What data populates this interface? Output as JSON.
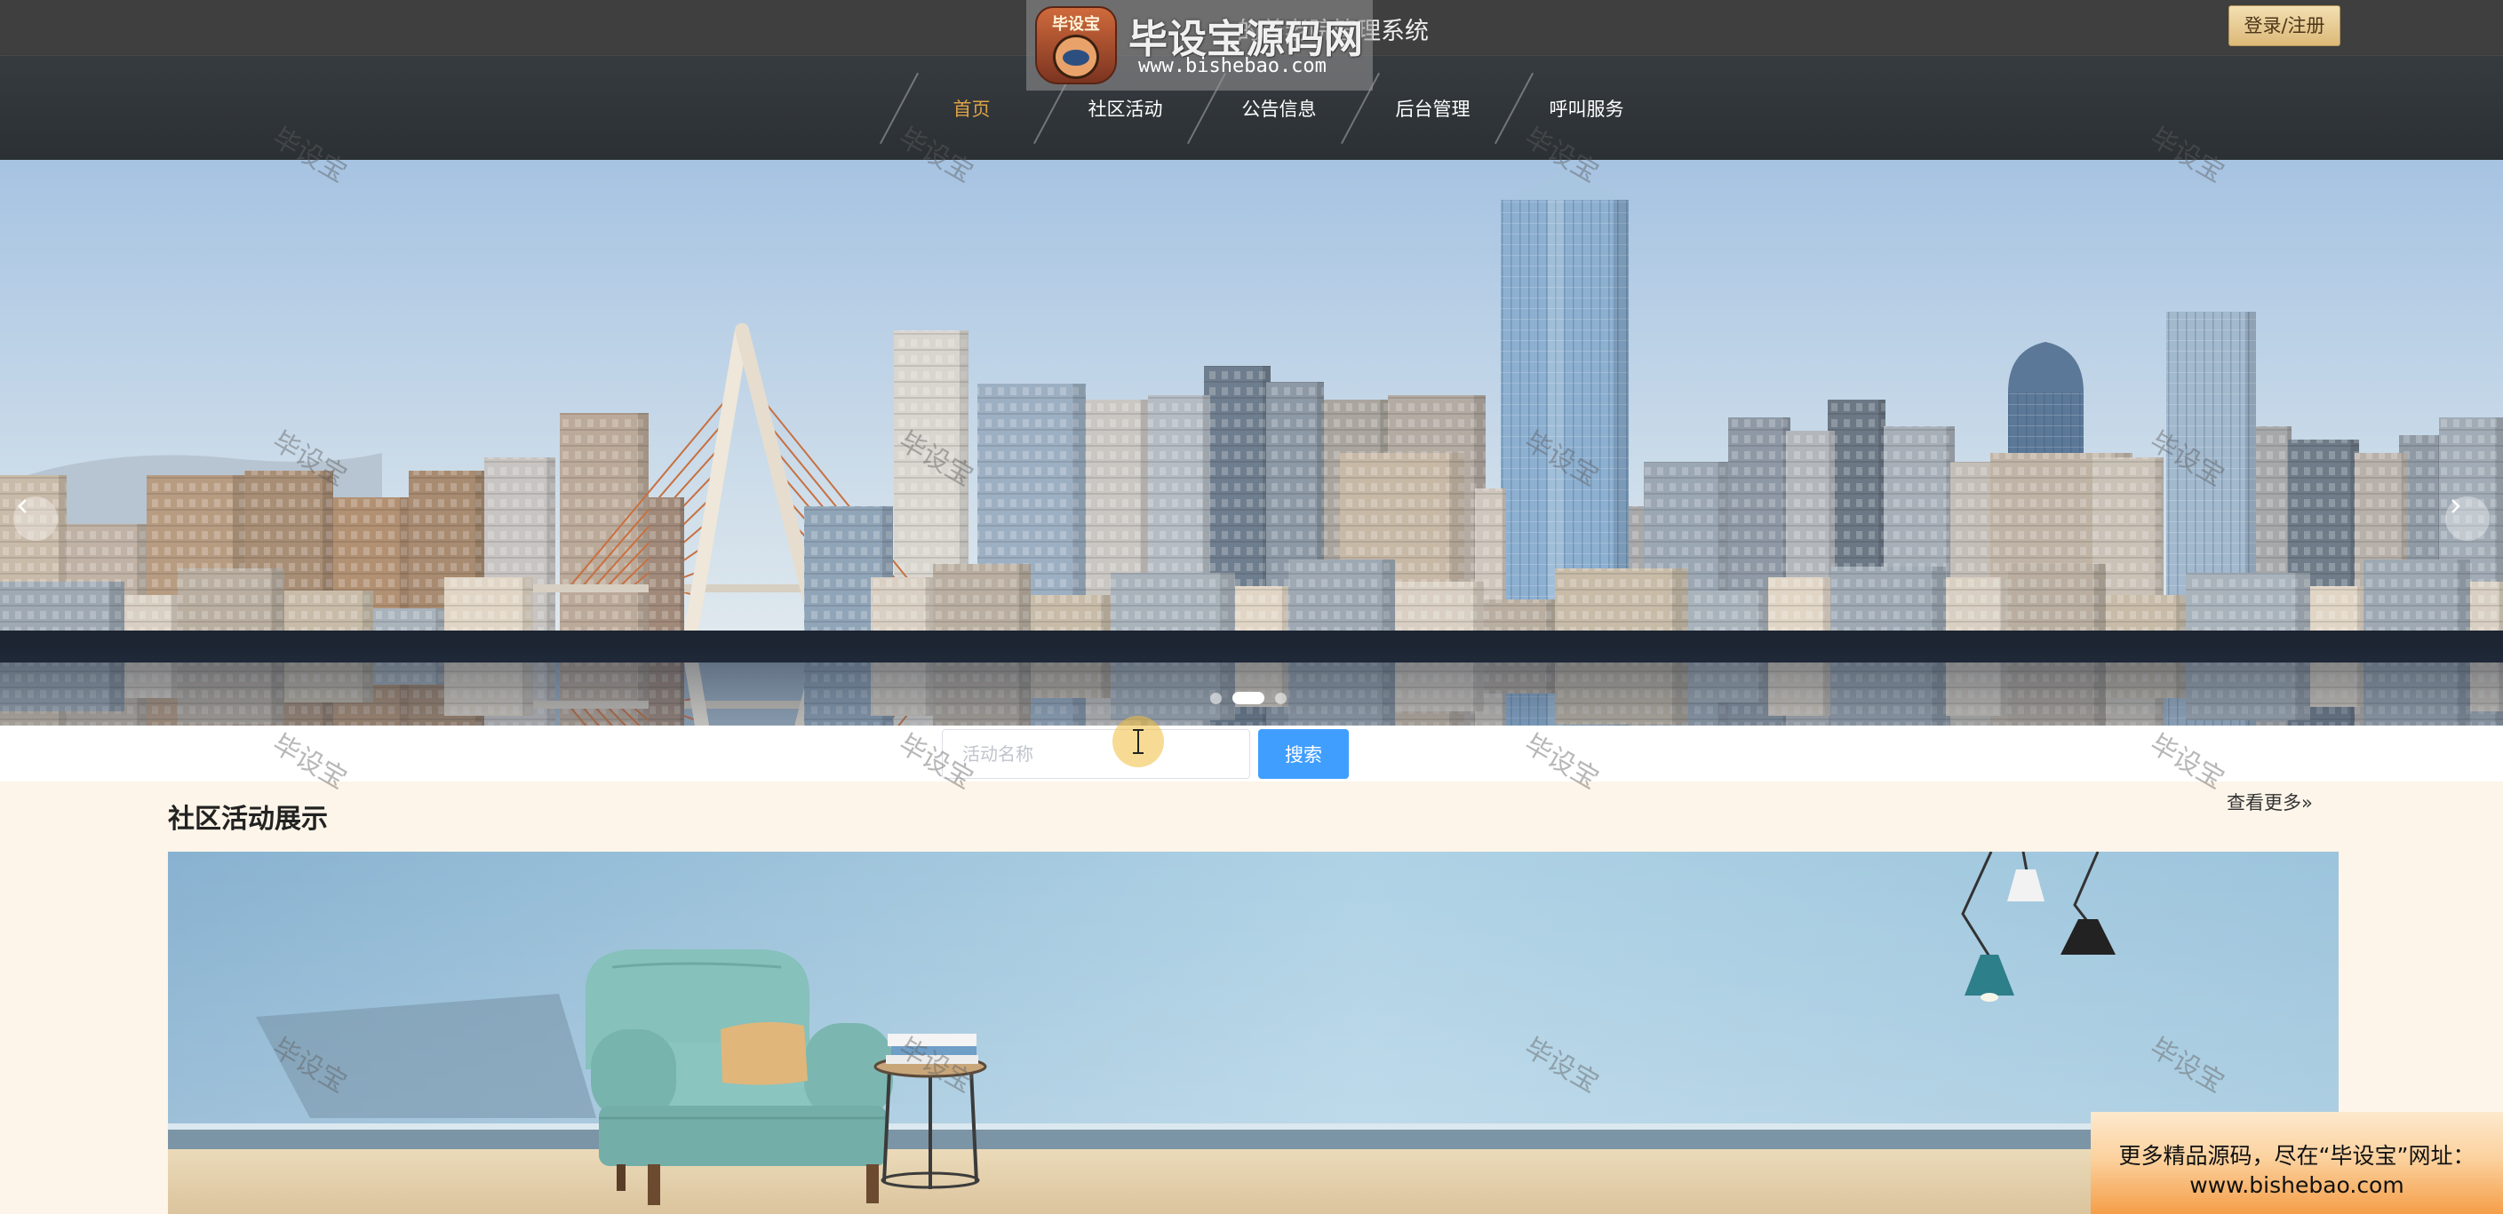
{
  "header": {
    "title": "的养老院管理系统",
    "login_label": "登录/注册"
  },
  "logo_watermark": {
    "badge_text": "毕设宝",
    "name": "毕设宝源码网",
    "url": "www.bishebao.com"
  },
  "nav": {
    "items": [
      {
        "label": "首页",
        "active": true
      },
      {
        "label": "社区活动",
        "active": false
      },
      {
        "label": "公告信息",
        "active": false
      },
      {
        "label": "后台管理",
        "active": false
      },
      {
        "label": "呼叫服务",
        "active": false
      }
    ]
  },
  "banner": {
    "slide_count": 3,
    "active_slide": 2,
    "prev_icon": "chevron-left-icon",
    "next_icon": "chevron-right-icon"
  },
  "search": {
    "placeholder": "活动名称",
    "button_label": "搜索"
  },
  "activities": {
    "title": "社区活动展示",
    "more_label": "查看更多»"
  },
  "watermark": {
    "text": "毕设宝"
  },
  "promo": {
    "line1": "更多精品源码，尽在“毕设宝”网址：",
    "line2": "www.bishebao.com"
  },
  "colors": {
    "header_bg": "#3f3f3f",
    "nav_bg": "#2e3337",
    "nav_active": "#e0a346",
    "search_button": "#409eff",
    "section_bg": "#fdf5e9"
  }
}
